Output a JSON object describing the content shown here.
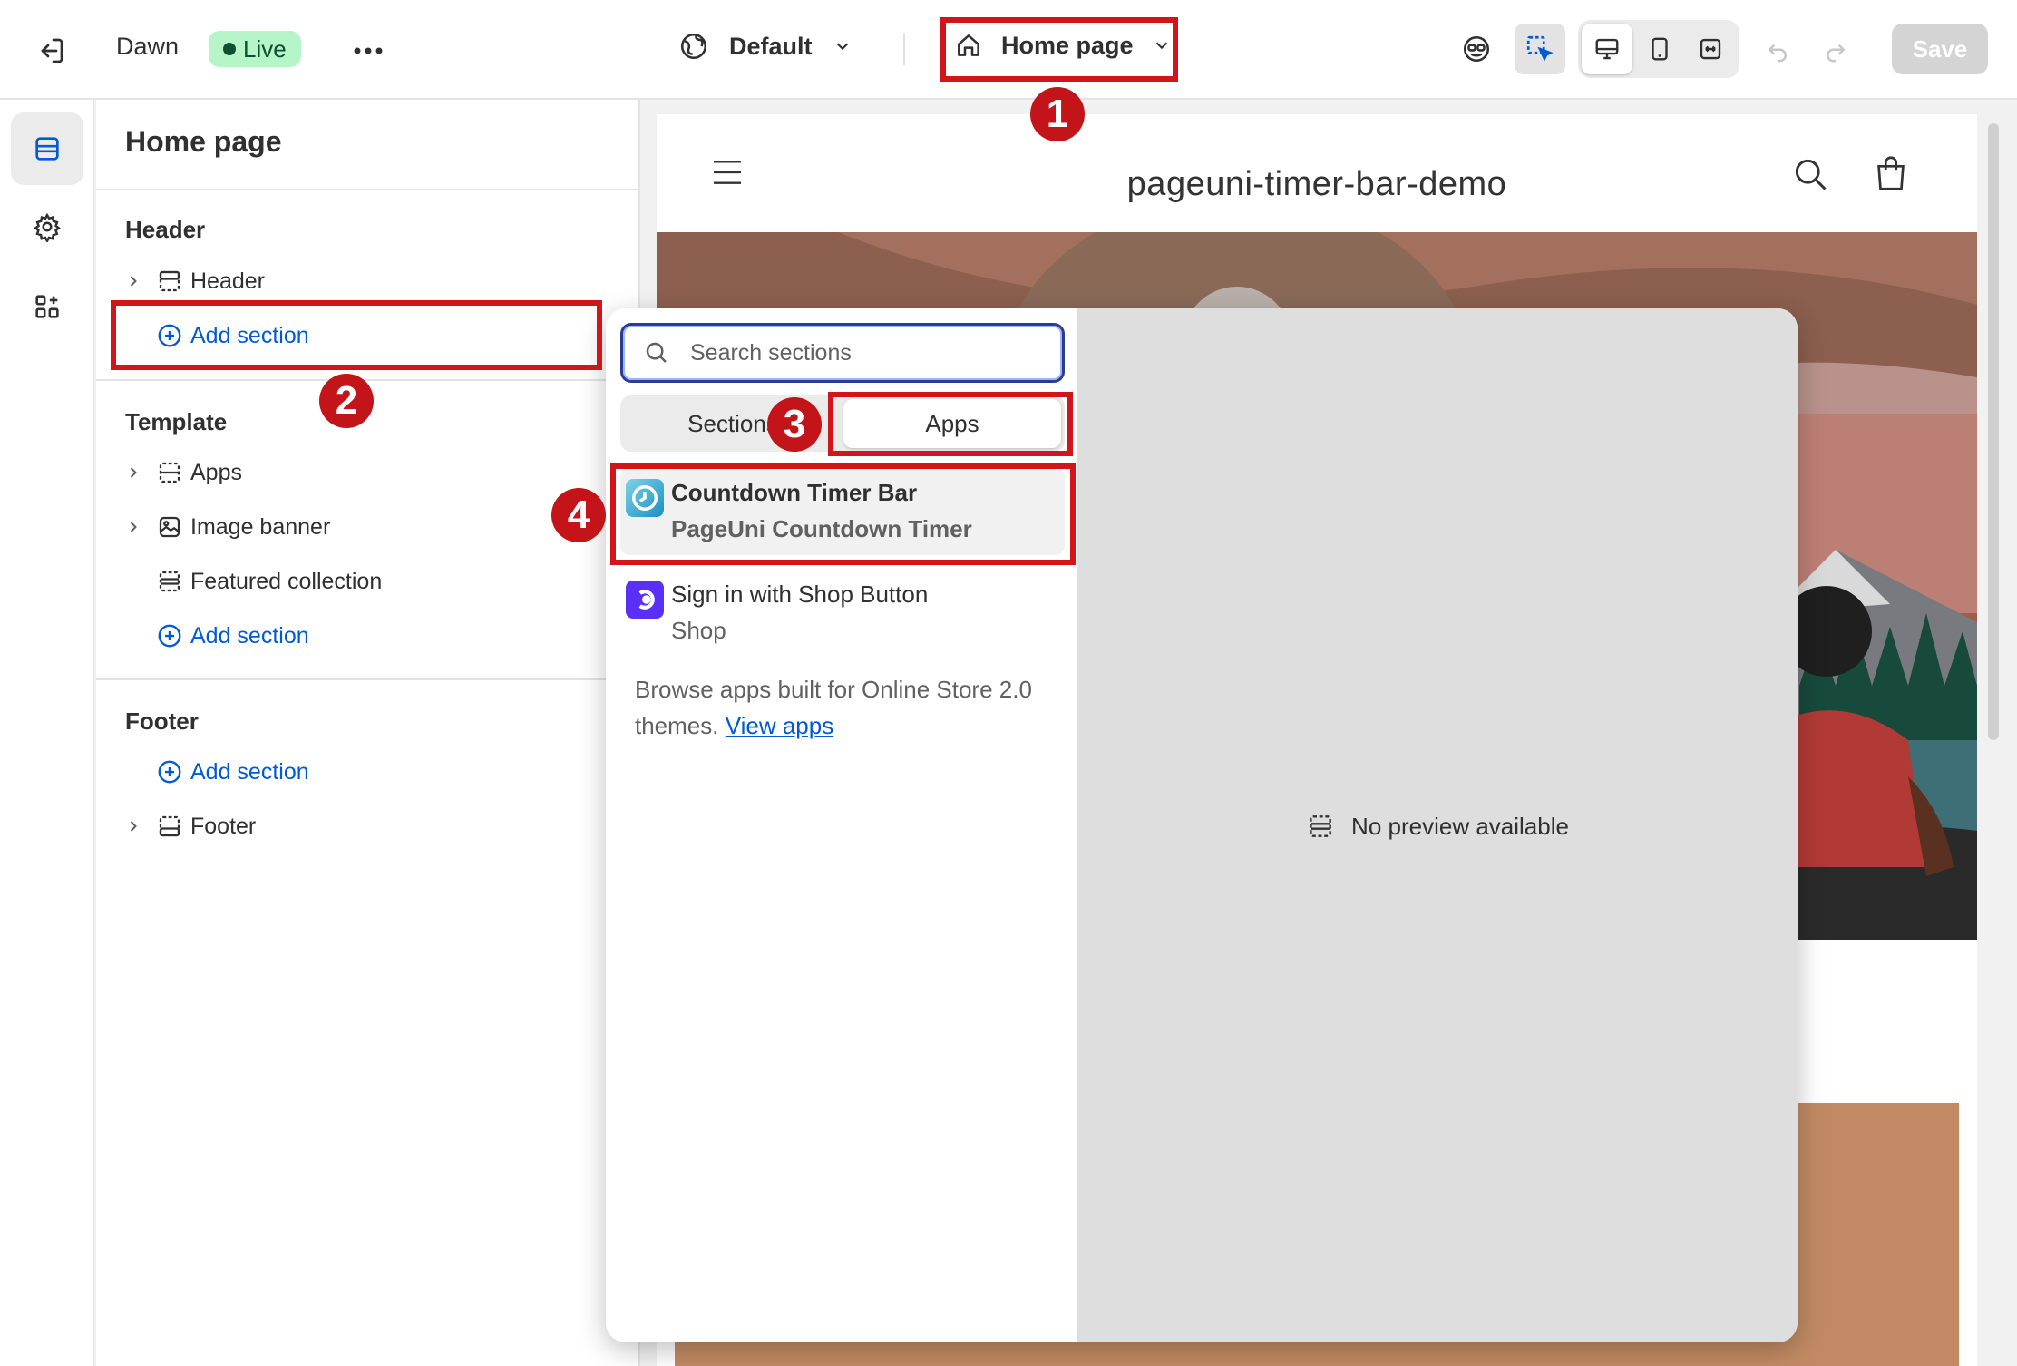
{
  "topbar": {
    "theme_name": "Dawn",
    "live_badge": "Live",
    "more_icon": "ellipsis-icon",
    "market_label": "Default",
    "page_selector": "Home page",
    "save_label": "Save"
  },
  "sidebar": {
    "title": "Home page",
    "header_group": {
      "heading": "Header",
      "items": [
        {
          "label": "Header"
        }
      ],
      "add_label": "Add section"
    },
    "template_group": {
      "heading": "Template",
      "items": [
        {
          "label": "Apps"
        },
        {
          "label": "Image banner"
        },
        {
          "label": "Featured collection"
        }
      ],
      "add_label": "Add section"
    },
    "footer_group": {
      "heading": "Footer",
      "add_label": "Add section",
      "items": [
        {
          "label": "Footer"
        }
      ]
    }
  },
  "popover": {
    "search_placeholder": "Search sections",
    "tabs": [
      "Sections",
      "Apps"
    ],
    "apps": [
      {
        "name": "Countdown Timer Bar",
        "vendor": "PageUni Countdown Timer"
      },
      {
        "name": "Sign in with Shop Button",
        "vendor": "Shop"
      }
    ],
    "browse_text": "Browse apps built for Online Store 2.0 themes.",
    "browse_link": "View apps",
    "no_preview": "No preview available"
  },
  "store": {
    "title": "pageuni-timer-bar-demo"
  },
  "annotations": [
    "1",
    "2",
    "3",
    "4"
  ],
  "colors": {
    "accent_blue": "#005bd3",
    "annotation_red": "#d0161a",
    "live_green": "#b5f5c8"
  }
}
